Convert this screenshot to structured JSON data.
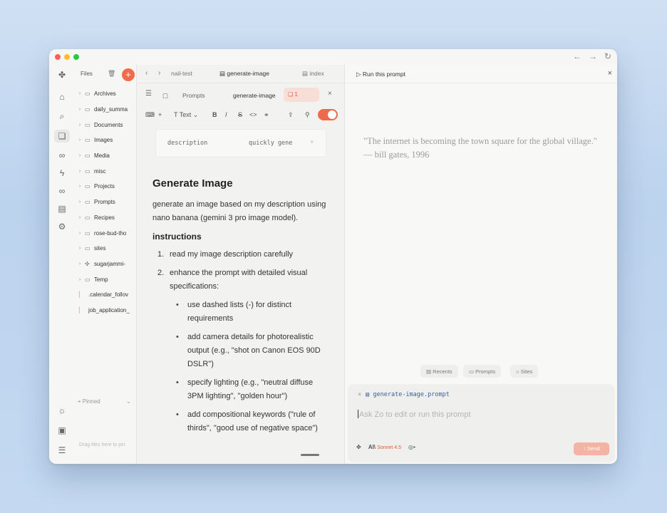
{
  "window": {
    "nav_back": "←",
    "nav_forward": "→",
    "nav_refresh": "↻"
  },
  "rail": {
    "icons": [
      "logo-icon",
      "home-icon",
      "search-icon",
      "chat-icon",
      "infinity-icon",
      "bolt-icon",
      "binoculars-icon",
      "storage-icon",
      "settings-icon",
      "sun-icon",
      "image-icon",
      "list-icon"
    ]
  },
  "files": {
    "title": "Files",
    "add_label": "+",
    "items": [
      {
        "label": "Archives",
        "kind": "folder"
      },
      {
        "label": "daily_summa",
        "kind": "folder"
      },
      {
        "label": "Documents",
        "kind": "folder"
      },
      {
        "label": "Images",
        "kind": "folder"
      },
      {
        "label": "Media",
        "kind": "folder"
      },
      {
        "label": "misc",
        "kind": "folder"
      },
      {
        "label": "Projects",
        "kind": "folder"
      },
      {
        "label": "Prompts",
        "kind": "folder"
      },
      {
        "label": "Recipes",
        "kind": "folder"
      },
      {
        "label": "rose-bud-tho",
        "kind": "folder"
      },
      {
        "label": "sites",
        "kind": "folder"
      },
      {
        "label": "sugarjammi-",
        "kind": "special"
      },
      {
        "label": "Temp",
        "kind": "folder"
      },
      {
        "label": ".calendar_follov",
        "kind": "file"
      },
      {
        "label": "job_application_",
        "kind": "file"
      }
    ],
    "pinned_label": "Pinned",
    "drag_note": "Drag files here to pin"
  },
  "editor": {
    "tabs": [
      "nail-test",
      "generate-image",
      "index"
    ],
    "breadcrumb": {
      "folder": "Prompts",
      "file": "generate-image",
      "comment_count": "1"
    },
    "toolbar": {
      "text_style": "Text",
      "bold": "B",
      "italic": "I",
      "strike": "S",
      "code": "<>",
      "link": "🔗"
    },
    "properties": {
      "key": "description",
      "value": "quickly gene"
    },
    "doc": {
      "title": "Generate Image",
      "intro": "generate an image based on my description using nano banana (gemini 3 pro image model).",
      "section": "instructions",
      "steps": [
        {
          "num": "1.",
          "text": "read my image description carefully"
        },
        {
          "num": "2.",
          "text": "enhance the prompt with detailed visual specifications:"
        }
      ],
      "bullets": [
        "use dashed lists (-) for distinct requirements",
        "add camera details for photorealistic output (e.g., \"shot on Canon EOS 90D DSLR\")",
        "specify lighting (e.g., \"neutral diffuse 3PM lighting\", \"golden hour\")",
        "add compositional keywords (\"rule of thirds\", \"good use of negative space\")"
      ]
    }
  },
  "chat": {
    "run_label": "Run this prompt",
    "quote_line1": "\"The internet is becoming the town square for the global village.\"",
    "quote_line2": "— bill gates, 1996",
    "quick_actions": [
      "Recents",
      "Prompts",
      "Sites"
    ],
    "attached_file": "generate-image.prompt",
    "input_placeholder": "Ask Zo to edit or run this prompt",
    "model_label": "Sonnet 4.5",
    "send_label": "Send"
  },
  "colors": {
    "accent": "#f26b4a",
    "link": "#3a5f9e"
  }
}
